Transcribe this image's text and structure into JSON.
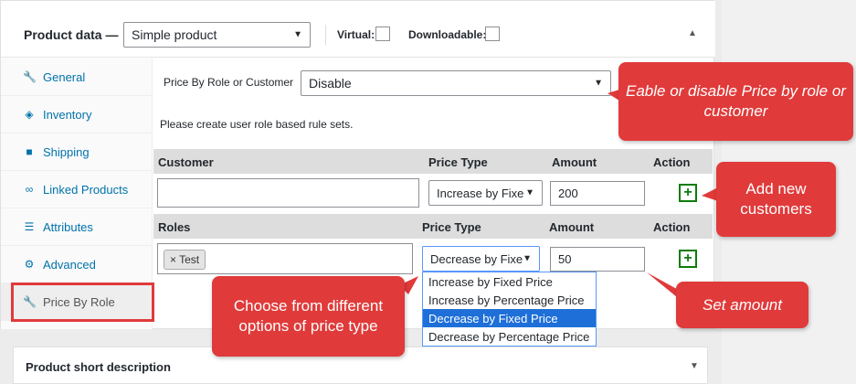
{
  "header": {
    "title": "Product data —",
    "product_type": "Simple product",
    "virtual_label": "Virtual:",
    "downloadable_label": "Downloadable:"
  },
  "sidebar": {
    "items": [
      {
        "label": "General",
        "icon": "wrench-icon"
      },
      {
        "label": "Inventory",
        "icon": "tag-icon"
      },
      {
        "label": "Shipping",
        "icon": "truck-icon"
      },
      {
        "label": "Linked Products",
        "icon": "link-icon"
      },
      {
        "label": "Attributes",
        "icon": "list-icon"
      },
      {
        "label": "Advanced",
        "icon": "gear-icon"
      },
      {
        "label": "Price By Role",
        "icon": "wrench-icon"
      }
    ]
  },
  "main": {
    "pbr_label": "Price By Role or Customer",
    "pbr_value": "Disable",
    "help": "Please create user role based rule sets.",
    "customer_table": {
      "headers": [
        "Customer",
        "Price Type",
        "Amount",
        "Action"
      ],
      "customer_value": "",
      "price_type": "Increase by Fixe",
      "amount": "200",
      "add": "+"
    },
    "roles_table": {
      "headers": [
        "Roles",
        "Price Type",
        "Amount",
        "Action"
      ],
      "tag": "× Test",
      "price_type": "Decrease by Fixe",
      "amount": "50",
      "add": "+"
    },
    "dropdown_options": [
      "Increase by Fixed Price",
      "Increase by Percentage Price",
      "Decrease by Fixed Price",
      "Decrease by Percentage Price"
    ],
    "dropdown_selected_index": 2
  },
  "callouts": {
    "enable": "Eable or disable Price by role or customer",
    "add_customers": "Add new customers",
    "price_type": "Choose from different options of price type",
    "amount": "Set amount"
  },
  "short_description": {
    "title": "Product short description"
  },
  "colors": {
    "callout": "#e03a3a",
    "link": "#0073aa",
    "add_button": "#0a7d0a",
    "selected_option": "#1e6fd8"
  }
}
